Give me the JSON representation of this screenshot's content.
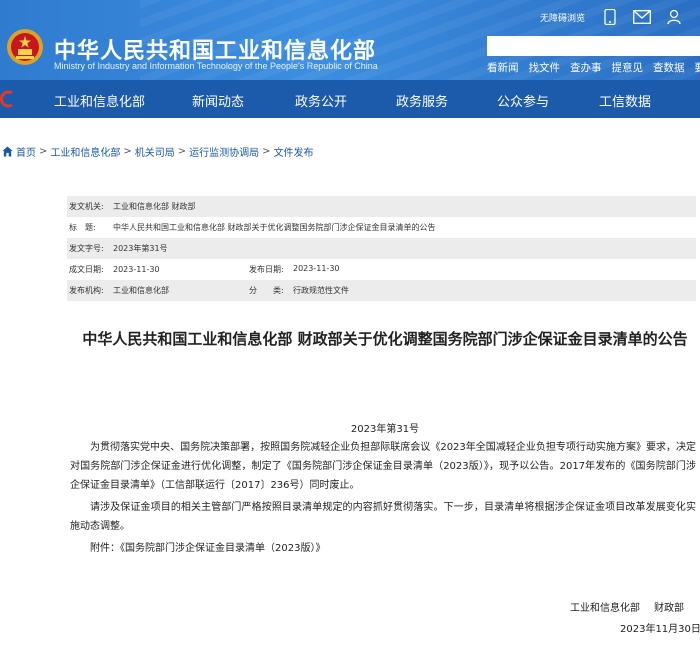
{
  "header": {
    "title": "中华人民共和国工业和信息化部",
    "subtitle": "Ministry of Industry and Information Technology of the People's Republic of China",
    "accessibility_label": "无障碍浏览",
    "quick_links": [
      "看新闻",
      "找文件",
      "查办事",
      "提意见",
      "查数据",
      "要"
    ],
    "nav": [
      "工业和信息化部",
      "新闻动态",
      "政务公开",
      "政务服务",
      "公众参与",
      "工信数据"
    ]
  },
  "breadcrumb": [
    "首页",
    "工业和信息化部",
    "机关司局",
    "运行监测协调局",
    "文件发布"
  ],
  "info": {
    "issuer_label": "发文机关:",
    "issuer": "工业和信息化部 财政部",
    "title_label": "标　题:",
    "title": "中华人民共和国工业和信息化部 财政部关于优化调整国务院部门涉企保证金目录清单的公告",
    "doc_no_label": "发文字号:",
    "doc_no": "2023年第31号",
    "created_label": "成文日期:",
    "created": "2023-11-30",
    "published_label": "发布日期:",
    "published": "2023-11-30",
    "publisher_label": "发布机构:",
    "publisher": "工业和信息化部",
    "category_label": "分　　类:",
    "category": "行政规范性文件"
  },
  "article": {
    "title": "中华人民共和国工业和信息化部 财政部关于优化调整国务院部门涉企保证金目录清单的公告",
    "number": "2023年第31号",
    "paragraphs": [
      "为贯彻落实党中央、国务院决策部署，按照国务院减轻企业负担部际联席会议《2023年全国减轻企业负担专项行动实施方案》要求，决定对国务院部门涉企保证金进行优化调整，制定了《国务院部门涉企保证金目录清单（2023版）》，现予以公告。2017年发布的《国务院部门涉企保证金目录清单》（工信部联运行〔2017〕236号）同时废止。",
      "请涉及保证金项目的相关主管部门严格按照目录清单规定的内容抓好贯彻落实。下一步，目录清单将根据涉企保证金项目改革发展变化实施动态调整。",
      "附件：《国务院部门涉企保证金目录清单（2023版）》"
    ],
    "sign_org1": "工业和信息化部",
    "sign_org2": "财政部",
    "sign_date": "2023年11月30日"
  },
  "colors": {
    "header_blue": "#2f7bd0",
    "nav_blue": "#1c5aab",
    "link": "#1a57a8"
  }
}
